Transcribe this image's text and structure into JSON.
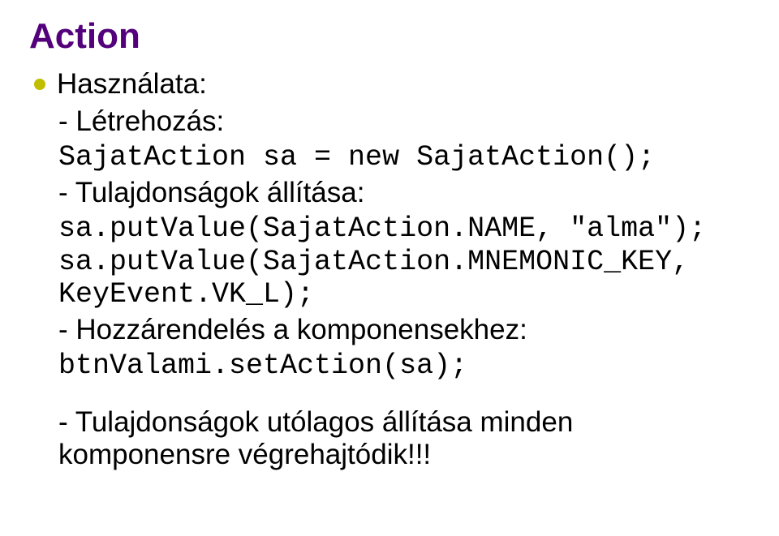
{
  "title": "Action",
  "bullet_label": "Használata:",
  "sections": {
    "create": {
      "heading": "- Létrehozás:",
      "code": "SajatAction sa = new SajatAction();"
    },
    "props": {
      "heading": "- Tulajdonságok állítása:",
      "code_line1": "sa.putValue(SajatAction.NAME, \"alma\");",
      "code_line2": "sa.putValue(SajatAction.MNEMONIC_KEY, KeyEvent.VK_L);"
    },
    "assign": {
      "heading": "- Hozzárendelés a komponensekhez:",
      "code": "btnValami.setAction(sa);"
    },
    "note": {
      "text": "- Tulajdonságok utólagos állítása minden komponensre végrehajtódik!!!"
    }
  }
}
